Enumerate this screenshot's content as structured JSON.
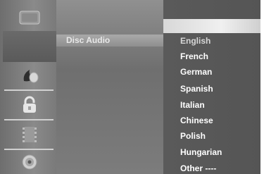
{
  "menu": {
    "current_item": "Disc Audio"
  },
  "sidebar": {
    "icons": [
      "disc-icon",
      "language-icon",
      "lock-icon",
      "film-icon",
      "dvd-icon"
    ]
  },
  "options": [
    "English",
    "French",
    "German",
    "Spanish",
    "Italian",
    "Chinese",
    "Polish",
    "Hungarian",
    "Other  ----"
  ],
  "colors": {
    "background": "#7e7e7e",
    "options_panel": "#565656",
    "highlight": "#e8e8e8",
    "text": "#ffffff"
  }
}
